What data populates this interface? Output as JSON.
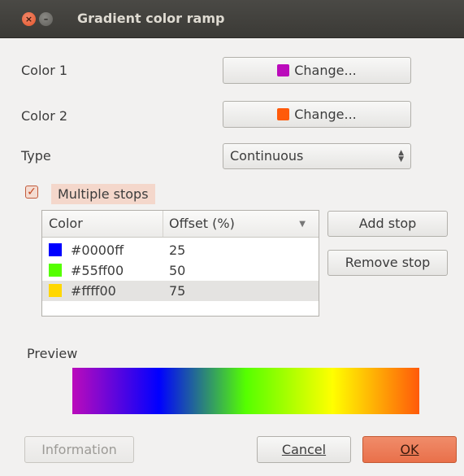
{
  "window": {
    "title": "Gradient color ramp",
    "close_glyph": "×",
    "minimize_glyph": "–"
  },
  "color1": {
    "label": "Color 1",
    "button_label": "Change...",
    "swatch_color": "#bb0bbb"
  },
  "color2": {
    "label": "Color 2",
    "button_label": "Change...",
    "swatch_color": "#ff5a0a"
  },
  "type": {
    "label": "Type",
    "value": "Continuous"
  },
  "multiple_stops": {
    "label": "Multiple stops",
    "checked": true
  },
  "stops_table": {
    "headers": [
      "Color",
      "Offset (%)"
    ],
    "rows": [
      {
        "swatch": "#0000ff",
        "hex": "#0000ff",
        "offset": "25"
      },
      {
        "swatch": "#55ff00",
        "hex": "#55ff00",
        "offset": "50"
      },
      {
        "swatch": "#ffd700",
        "hex": "#ffff00",
        "offset": "75"
      }
    ],
    "selected_row": 2
  },
  "buttons": {
    "add_stop": "Add stop",
    "remove_stop": "Remove stop",
    "information": "Information",
    "cancel": "Cancel",
    "ok": "OK"
  },
  "preview": {
    "label": "Preview",
    "gradient_stops": [
      {
        "color": "#bb0bbb",
        "offset": 0
      },
      {
        "color": "#0000ff",
        "offset": 25
      },
      {
        "color": "#55ff00",
        "offset": 50
      },
      {
        "color": "#ffff00",
        "offset": 75
      },
      {
        "color": "#ff5a0a",
        "offset": 100
      }
    ]
  },
  "colors": {
    "accent": "#e9704a",
    "titlebar": "#3c3b37"
  }
}
